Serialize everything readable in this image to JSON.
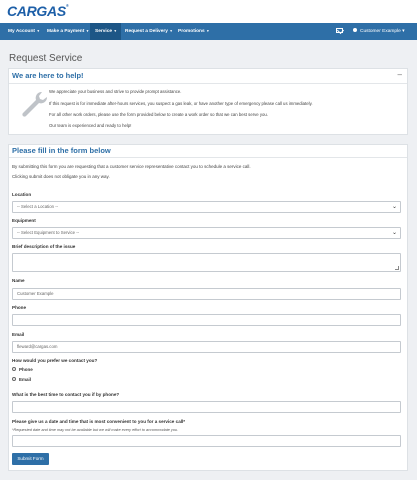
{
  "brand": {
    "logo_text": "CARGAS",
    "trademark": "®"
  },
  "nav": {
    "items": [
      {
        "label": "My Account"
      },
      {
        "label": "Make a Payment"
      },
      {
        "label": "Service"
      },
      {
        "label": "Request a Delivery"
      },
      {
        "label": "Promotions"
      }
    ],
    "active": "Service",
    "user_label": "Customer Example"
  },
  "page": {
    "title": "Request Service"
  },
  "help_panel": {
    "title": "We are here to help!",
    "toggle": "–",
    "paragraphs": [
      "We appreciate your business and strive to provide prompt assistance.",
      "If this request is for immediate after-hours services, you suspect a gas leak, or have another type of emergency please call us immediately.",
      "For all other work orders, please use the form provided below to create a work order so that we can best serve you.",
      "Our team is experienced and ready to help!"
    ]
  },
  "form": {
    "title": "Please fill in the form below",
    "intro": [
      "By submitting this form you are requesting that a customer service representative contact you to schedule a service call.",
      "Clicking submit does not obligate you in any way."
    ],
    "location": {
      "label": "Location",
      "value": "-- Select a Location --"
    },
    "equipment": {
      "label": "Equipment",
      "value": "-- Select Equipment to Service --"
    },
    "description": {
      "label": "Brief description of the issue",
      "value": ""
    },
    "name": {
      "label": "Name",
      "value": "Customer Example"
    },
    "phone": {
      "label": "Phone",
      "value": ""
    },
    "email": {
      "label": "Email",
      "value": "fleward@cargas.com"
    },
    "contact_pref": {
      "label": "How would you prefer we contact you?",
      "options": [
        "Phone",
        "Email"
      ]
    },
    "best_time": {
      "label": "What is the best time to contact you if by phone?",
      "value": ""
    },
    "service_date": {
      "label": "Please give us a date and time that is most convenient to you for a service call*",
      "note": "*Requested date and time may not be available but we will make every effort to accommodate you.",
      "value": ""
    },
    "submit_label": "Submit Form"
  },
  "colors": {
    "brand_blue": "#2e6fa7",
    "nav_active": "#1d5686",
    "background": "#eef0f3"
  }
}
